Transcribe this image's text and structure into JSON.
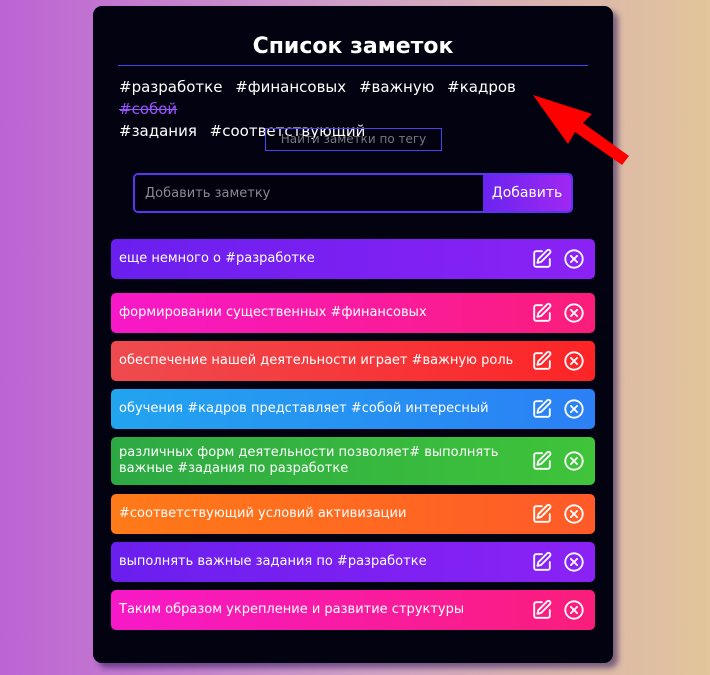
{
  "app": {
    "title": "Список заметок",
    "tags": [
      "#разработке",
      "#финансовых",
      "#важную",
      "#кадров",
      "#собой",
      "#задания",
      "#соответствующий"
    ],
    "selected_tag": "#собой",
    "find_button": "Найти заметки по тегу",
    "add_input": {
      "placeholder": "Добавить заметку",
      "value": ""
    },
    "add_button": "Добавить"
  },
  "notes": [
    {
      "text": "еще немного о #разработке",
      "color": "purple"
    },
    {
      "text": "формировании существенных #финансовых",
      "color": "pink"
    },
    {
      "text": "обеспечение нашей деятельности играет #важную роль",
      "color": "red"
    },
    {
      "text": "обучения #кадров представляет #собой интересный",
      "color": "blue"
    },
    {
      "text": "различных форм деятельности позволяет# выполнять важные #задания по разработке",
      "color": "green"
    },
    {
      "text": "#соответствующий условий активизации",
      "color": "orange"
    },
    {
      "text": "выполнять важные задания по #разработке",
      "color": "purple"
    },
    {
      "text": "Таким образом укрепление и развитие структуры",
      "color": "pink"
    }
  ],
  "icons": {
    "edit": "edit-icon",
    "delete": "close-circle-icon",
    "annotation": "red-arrow-icon"
  },
  "colors": {
    "panel": "#030211",
    "accent": "#5a34f0",
    "selected_tag": "#9955ff",
    "purple": "#7a20f2",
    "pink": "#f91ab0",
    "red": "#f5353a",
    "blue": "#2592f2",
    "green": "#35b63f",
    "orange": "#ff6a20",
    "arrow": "#ff0000"
  }
}
